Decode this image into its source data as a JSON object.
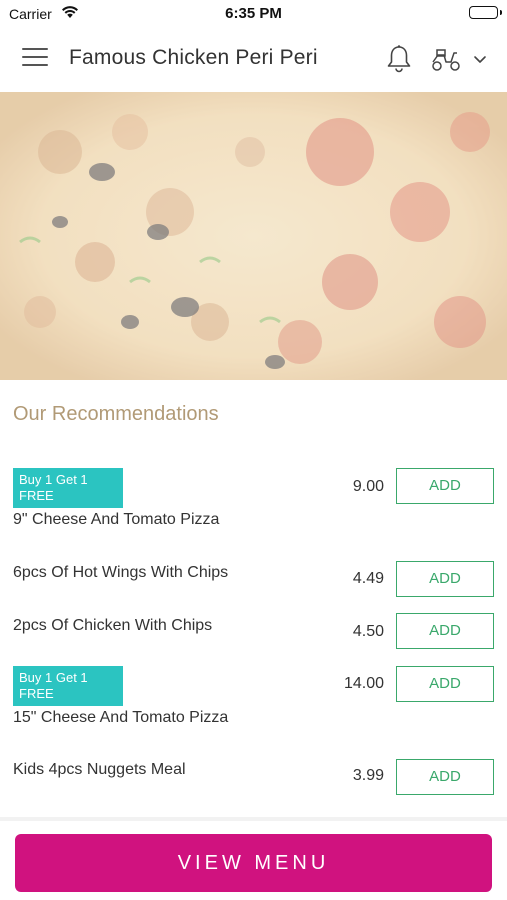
{
  "status_bar": {
    "carrier": "Carrier",
    "time": "6:35 PM"
  },
  "header": {
    "title": "Famous Chicken Peri Peri",
    "icons": [
      "menu-icon",
      "bell-icon",
      "scooter-icon",
      "chevron-down-icon"
    ]
  },
  "hero": {
    "image": "pizza photo"
  },
  "recommendations": {
    "title": "Our Recommendations",
    "items": [
      {
        "badge": "Buy 1 Get 1 FREE",
        "name": "9\" Cheese And Tomato Pizza",
        "price": "9.00",
        "add_label": "ADD"
      },
      {
        "badge": "",
        "name": "6pcs Of Hot Wings With Chips",
        "price": "4.49",
        "add_label": "ADD"
      },
      {
        "badge": "",
        "name": "2pcs Of Chicken With Chips",
        "price": "4.50",
        "add_label": "ADD"
      },
      {
        "badge": "Buy 1 Get 1 FREE",
        "name": "15\" Cheese And Tomato Pizza",
        "price": "14.00",
        "add_label": "ADD"
      },
      {
        "badge": "",
        "name": "Kids 4pcs Nuggets Meal",
        "price": "3.99",
        "add_label": "ADD"
      }
    ]
  },
  "footer": {
    "view_menu_label": "VIEW MENU"
  },
  "colors": {
    "accent": "#d0127f",
    "badge": "#2bc4c1",
    "add_button": "#3aa86b",
    "section_title": "#b19a76"
  }
}
